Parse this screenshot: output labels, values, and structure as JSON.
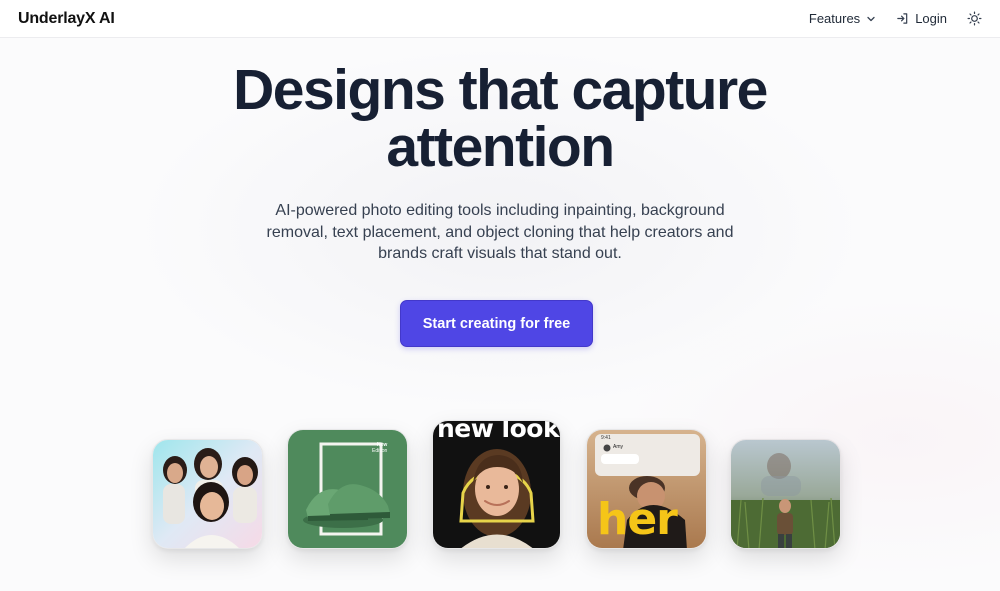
{
  "header": {
    "logo": "UnderlayX AI",
    "nav": {
      "features_label": "Features",
      "login_label": "Login"
    }
  },
  "hero": {
    "title_line1": "Designs that capture",
    "title_line2": "attention",
    "subtitle": "AI-powered photo editing tools including inpainting, background removal, text placement, and object cloning that help creators and brands craft visuals that stand out.",
    "cta_label": "Start creating for free"
  },
  "showcase": {
    "tile2_badge_line1": "New",
    "tile2_badge_line2": "Edition",
    "tile3_text": "new look",
    "tile4_text": "her",
    "tile4_chat_name": "Amy",
    "tile4_time": "9:41"
  },
  "colors": {
    "accent": "#4f46e5",
    "title": "#172033",
    "tile3_text": "#ffffff",
    "tile4_text": "#f5c518"
  }
}
